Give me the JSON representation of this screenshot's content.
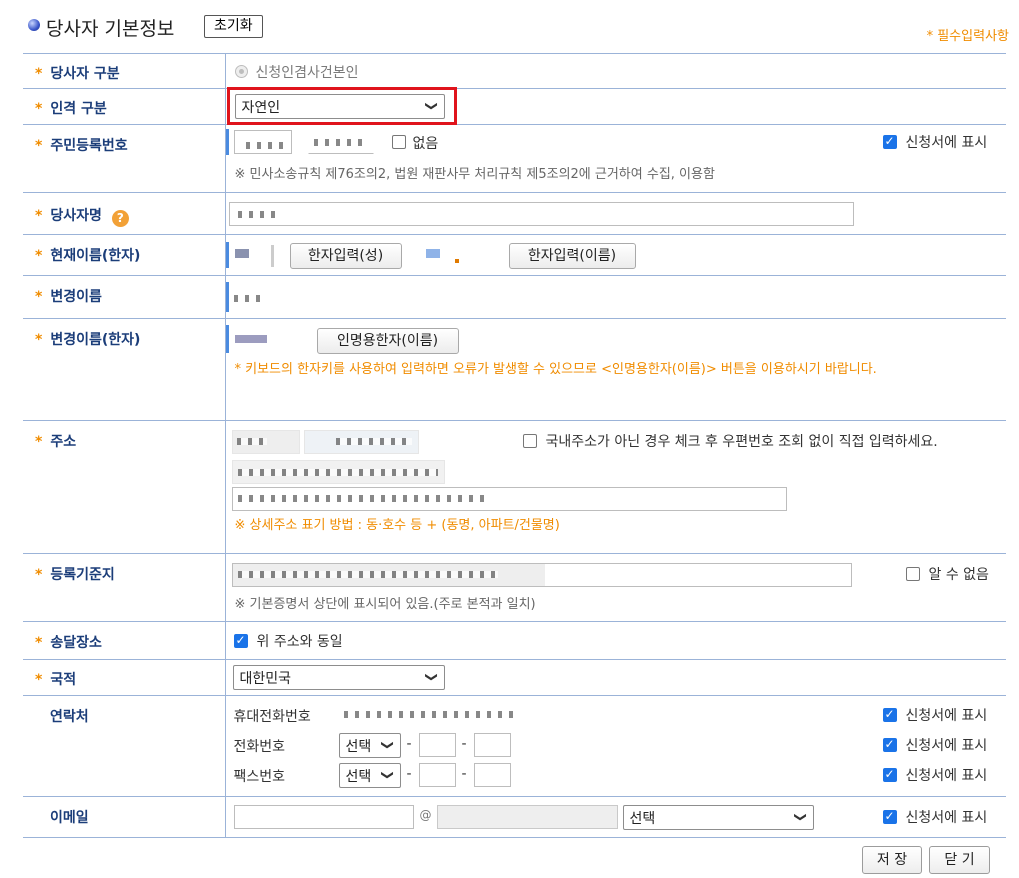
{
  "header": {
    "title": "당사자 기본정보",
    "reset_label": "초기화",
    "required_note": "* 필수입력사항"
  },
  "rows": {
    "party_type": {
      "label": "당사자 구분",
      "option_label": "신청인겸사건본인"
    },
    "person_type": {
      "label": "인격 구분",
      "selected": "자연인"
    },
    "resident_no": {
      "label": "주민등록번호",
      "none_label": "없음",
      "show_label": "신청서에 표시",
      "note": "※ 민사소송규칙 제76조의2, 법원 재판사무 처리규칙 제5조의2에 근거하여 수집, 이용함"
    },
    "party_name": {
      "label": "당사자명",
      "help_glyph": "?"
    },
    "current_name_hanja": {
      "label": "현재이름(한자)",
      "surname_btn": "한자입력(성)",
      "given_btn": "한자입력(이름)"
    },
    "changed_name": {
      "label": "변경이름"
    },
    "changed_name_hanja": {
      "label": "변경이름(한자)",
      "btn": "인명용한자(이름)",
      "warning": "* 키보드의 한자키를 사용하여 입력하면 오류가 발생할 수 있으므로 <인명용한자(이름)> 버튼을 이용하시기 바랍니다."
    },
    "address": {
      "label": "주소",
      "foreign_label": "국내주소가 아닌 경우 체크 후 우편번호 조회 없이 직접 입력하세요.",
      "note": "※ 상세주소 표기 방법 : 동·호수 등 + (동명, 아파트/건물명)"
    },
    "reg_base": {
      "label": "등록기준지",
      "unknown_label": "알 수 없음",
      "note": "※ 기본증명서 상단에 표시되어 있음.(주로 본적과 일치)"
    },
    "delivery": {
      "label": "송달장소",
      "same_label": "위 주소와 동일"
    },
    "nationality": {
      "label": "국적",
      "selected": "대한민국"
    },
    "contact": {
      "label": "연락처",
      "mobile_label": "휴대전화번호",
      "phone_label": "전화번호",
      "fax_label": "팩스번호",
      "select_label": "선택",
      "dash": "-",
      "show_label": "신청서에 표시"
    },
    "email": {
      "label": "이메일",
      "at": "@",
      "domain_select": "선택",
      "show_label": "신청서에 표시"
    }
  },
  "footer": {
    "save_label": "저 장",
    "close_label": "닫 기"
  },
  "colors": {
    "accent": "#1b3d79",
    "required": "#f08c00",
    "highlight": "#e0141c",
    "check": "#1a73e8"
  }
}
